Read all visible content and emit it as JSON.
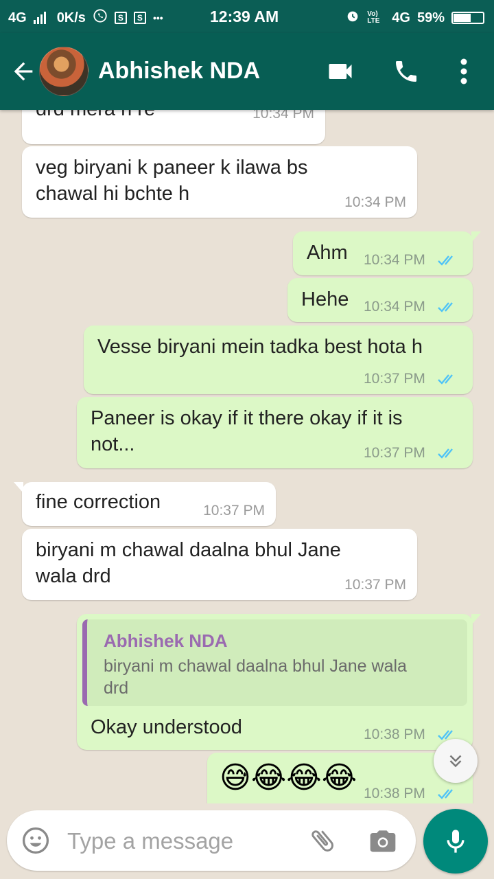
{
  "status_bar": {
    "network": "4G",
    "speed": "0K/s",
    "notif_s1": "S",
    "notif_s2": "S",
    "more": "•••",
    "time": "12:39 AM",
    "volte": "Vo) LTE",
    "network2": "4G",
    "battery": "59%"
  },
  "header": {
    "contact_name": "Abhishek NDA"
  },
  "messages": [
    {
      "dir": "in",
      "text": "drd mera h re",
      "time": "10:34 PM"
    },
    {
      "dir": "in",
      "text_lines": [
        "veg biryani k paneer k ilawa bs",
        "chawal hi bchte h"
      ],
      "time": "10:34 PM"
    },
    {
      "dir": "out",
      "text": "Ahm",
      "time": "10:34 PM",
      "status": "read"
    },
    {
      "dir": "out",
      "text": "Hehe",
      "time": "10:34 PM",
      "status": "read"
    },
    {
      "dir": "out",
      "text": "Vesse biryani mein tadka best hota h",
      "time": "10:37 PM",
      "status": "read"
    },
    {
      "dir": "out",
      "text_lines": [
        "Paneer is okay if it there okay if it is",
        "not..."
      ],
      "time": "10:37 PM",
      "status": "read"
    },
    {
      "dir": "in",
      "text": "fine correction",
      "time": "10:37 PM"
    },
    {
      "dir": "in",
      "text_lines": [
        "biryani m chawal daalna bhul Jane",
        "wala drd"
      ],
      "time": "10:37 PM"
    },
    {
      "dir": "out",
      "quote": {
        "name": "Abhishek NDA",
        "text_lines": [
          "biryani m chawal daalna bhul Jane wala",
          "drd"
        ]
      },
      "text": "Okay understood",
      "time": "10:38 PM",
      "status": "read"
    },
    {
      "dir": "out",
      "text": "😅😂😂😂",
      "time": "10:38 PM",
      "status": "read"
    }
  ],
  "composer": {
    "placeholder": "Type a message"
  },
  "colors": {
    "header": "#075e54",
    "status_bar": "#0b5e55",
    "outgoing_bubble": "#dcf8c6",
    "incoming_bubble": "#ffffff",
    "read_ticks": "#4fc3f7",
    "mic_button": "#00897b",
    "quote_accent": "#9a6ab0"
  },
  "icons": [
    "back-arrow-icon",
    "video-call-icon",
    "phone-icon",
    "more-vert-icon",
    "double-tick-icon",
    "chevron-down-icon",
    "emoji-icon",
    "attach-icon",
    "camera-icon",
    "mic-icon",
    "whatsapp-icon",
    "alarm-icon"
  ]
}
